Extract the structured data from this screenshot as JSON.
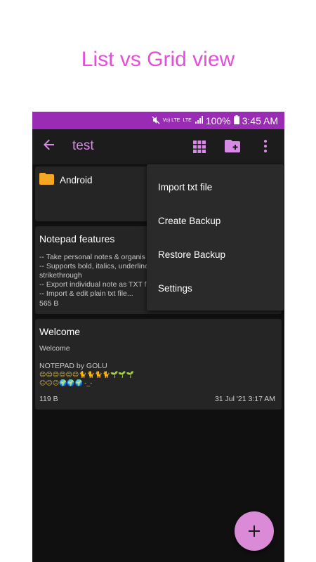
{
  "caption": "List vs Grid view",
  "status_bar": {
    "signal_top": "Vo) LTE",
    "lte_label": "LTE",
    "battery": "100%",
    "time": "3:45 AM"
  },
  "app_bar": {
    "title": "test",
    "icons": [
      "back-arrow-icon",
      "grid-view-icon",
      "new-folder-icon",
      "more-vert-icon"
    ]
  },
  "folder": {
    "name": "Android"
  },
  "notes": [
    {
      "title": "Notepad features",
      "preview": "-- Take personal notes & organis\n-- Supports bold, italics, underline\nstrikethrough\n-- Export individual note as TXT f\n-- Import & edit plain txt file...",
      "size": "565 B"
    },
    {
      "title": "Welcome",
      "preview_line1": "Welcome",
      "preview_line2": "NOTEPAD by GOLU",
      "emoji_line1": "😊😊😊😊😊😊🐈🐈🐈🐈🌱🌱🌱",
      "emoji_line2": "😐😐😐🌍🌍🌍 -_-",
      "size": "119 B",
      "date": "31 Jul '21 3:17 AM"
    }
  ],
  "menu": {
    "items": [
      "Import txt file",
      "Create Backup",
      "Restore Backup",
      "Settings"
    ]
  },
  "fab": {
    "label": "+"
  },
  "colors": {
    "accent": "#d98ae6",
    "status_bar": "#9a2bb4",
    "caption": "#e34fd8",
    "folder": "#f5a623",
    "fab": "#db8ad8"
  }
}
